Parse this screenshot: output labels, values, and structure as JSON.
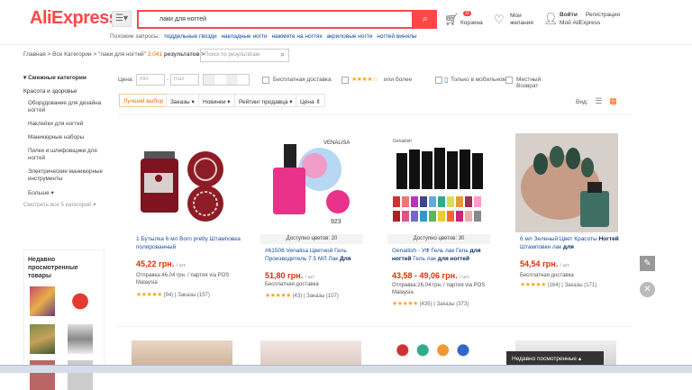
{
  "header": {
    "logo": "AliExpress",
    "search_value": "лаки для ногтей",
    "related_prefix": "Похожие запросы:",
    "related": [
      "поддельные гвозди",
      "накладные ногти",
      "нажмите на ногтях",
      "акриловые ногти",
      "ногтей винилы"
    ],
    "cart_count": "0",
    "cart_label": "Корзина",
    "wish_label_1": "Мои",
    "wish_label_2": "желания",
    "login": "Войти",
    "register": "Регистрация",
    "my_ali": "Мой AliExpress"
  },
  "breadcrumb": {
    "path": "Главная > Все Категории > \"лаки для ногтей\"",
    "count": "3,041",
    "suffix": "результатов >",
    "search_placeholder": "Поиск по результатам"
  },
  "sidebar": {
    "heading": "Смежные категории",
    "category": "Красота и здоровье",
    "items": [
      "Оборудование для дизайна ногтей",
      "Наклейки для ногтей",
      "Маникюрные наборы",
      "Пилки и шлифовщики для ногтей",
      "Электрические маникюрные инструменты"
    ],
    "more": "Больше",
    "all": "Смотреть все 5 категорий",
    "recent_title": "Недавно просмотренные товары"
  },
  "filters": {
    "price_label": "Цена:",
    "min_placeholder": "min",
    "max_placeholder": "max",
    "free_shipping": "Бесплатная доставка",
    "rating_suffix": "или более",
    "mobile_only": "Только в мобильном",
    "local_return": "Местный Возврат"
  },
  "sort": {
    "items": [
      "Лучший выбор",
      "Заказы",
      "Новинки",
      "Рейтинг продавца",
      "Цена"
    ],
    "view_label": "Вид:"
  },
  "products": [
    {
      "title": "1 Бутылка 6 мл Born pretty Штамповка полированный",
      "price": "45,22 грн.",
      "unit": "/ шт.",
      "ship": "Отправка:46,04 грн. / партия via POS Malaysia",
      "reviews": "(94)",
      "orders": "Заказы (157)",
      "avail": ""
    },
    {
      "title": "#61508 Venalisa Цветной Гель Производитель 7.5 МЛ Лак",
      "title_bold": "Для",
      "price": "51,80 грн.",
      "unit": "/ шт.",
      "ship": "Бесплатная доставка",
      "reviews": "(43)",
      "orders": "Заказы (107)",
      "avail": "Доступно цветов: 20"
    },
    {
      "title": "Genailish - УФ Гель лак Гель",
      "title_bold": "для ногтей",
      "title_mid": "Гель лак",
      "title_bold2": "для ногтей",
      "price": "43,58 - 49,06 грн.",
      "unit": "/ шт.",
      "ship": "Отправка:26,04 грн. / партия via POS Malaysia",
      "reviews": "(435)",
      "orders": "Заказы (373)",
      "avail": "Доступно цветов: 30"
    },
    {
      "title": "6 мл Зеленый Цвет Красоты",
      "title_bold": "Ногтей",
      "title_end": "Штамповки лак",
      "title_bold2": "для",
      "price": "54,54 грн.",
      "unit": "/ шт.",
      "ship": "Бесплатная доставка",
      "reviews": "(164)",
      "orders": "Заказы (171)",
      "avail": ""
    }
  ],
  "recent_bar": "Недавно посмотренные",
  "colors": {
    "accent": "#ff4747",
    "orange": "#f60",
    "price": "#e62e04",
    "link": "#1a4fa0"
  },
  "icons": [
    "menu-icon",
    "search-icon",
    "cart-icon",
    "heart-icon",
    "user-icon",
    "list-view-icon",
    "grid-view-icon",
    "edit-icon",
    "close-icon"
  ]
}
